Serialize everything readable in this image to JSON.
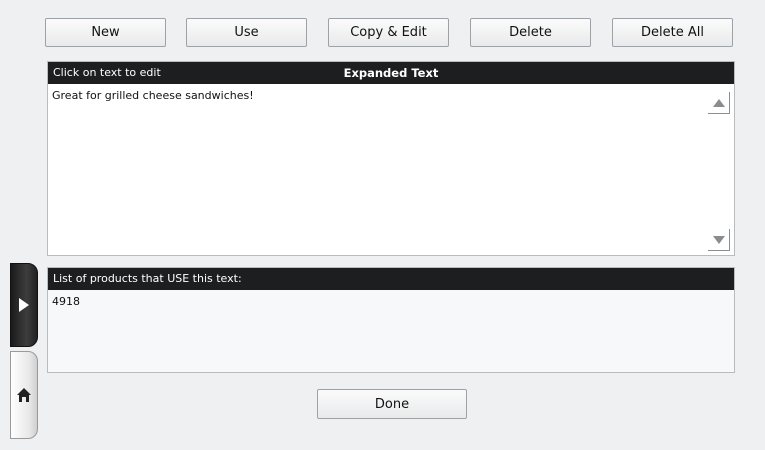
{
  "toolbar": {
    "new_label": "New",
    "use_label": "Use",
    "copy_edit_label": "Copy & Edit",
    "delete_label": "Delete",
    "delete_all_label": "Delete All"
  },
  "expanded_text_panel": {
    "hint": "Click on text to edit",
    "title": "Expanded Text",
    "content": "Great for grilled cheese sandwiches!"
  },
  "products_panel": {
    "title": "List of products that USE this text:",
    "items": [
      "4918"
    ]
  },
  "footer": {
    "done_label": "Done"
  },
  "icons": {
    "scroll_up": "triangle-up-icon",
    "scroll_down": "triangle-down-icon",
    "expand": "play-triangle-icon",
    "home": "home-icon"
  },
  "colors": {
    "background": "#eef0f1",
    "header_bar": "#1d1e1f",
    "header_text": "#ffffff"
  }
}
